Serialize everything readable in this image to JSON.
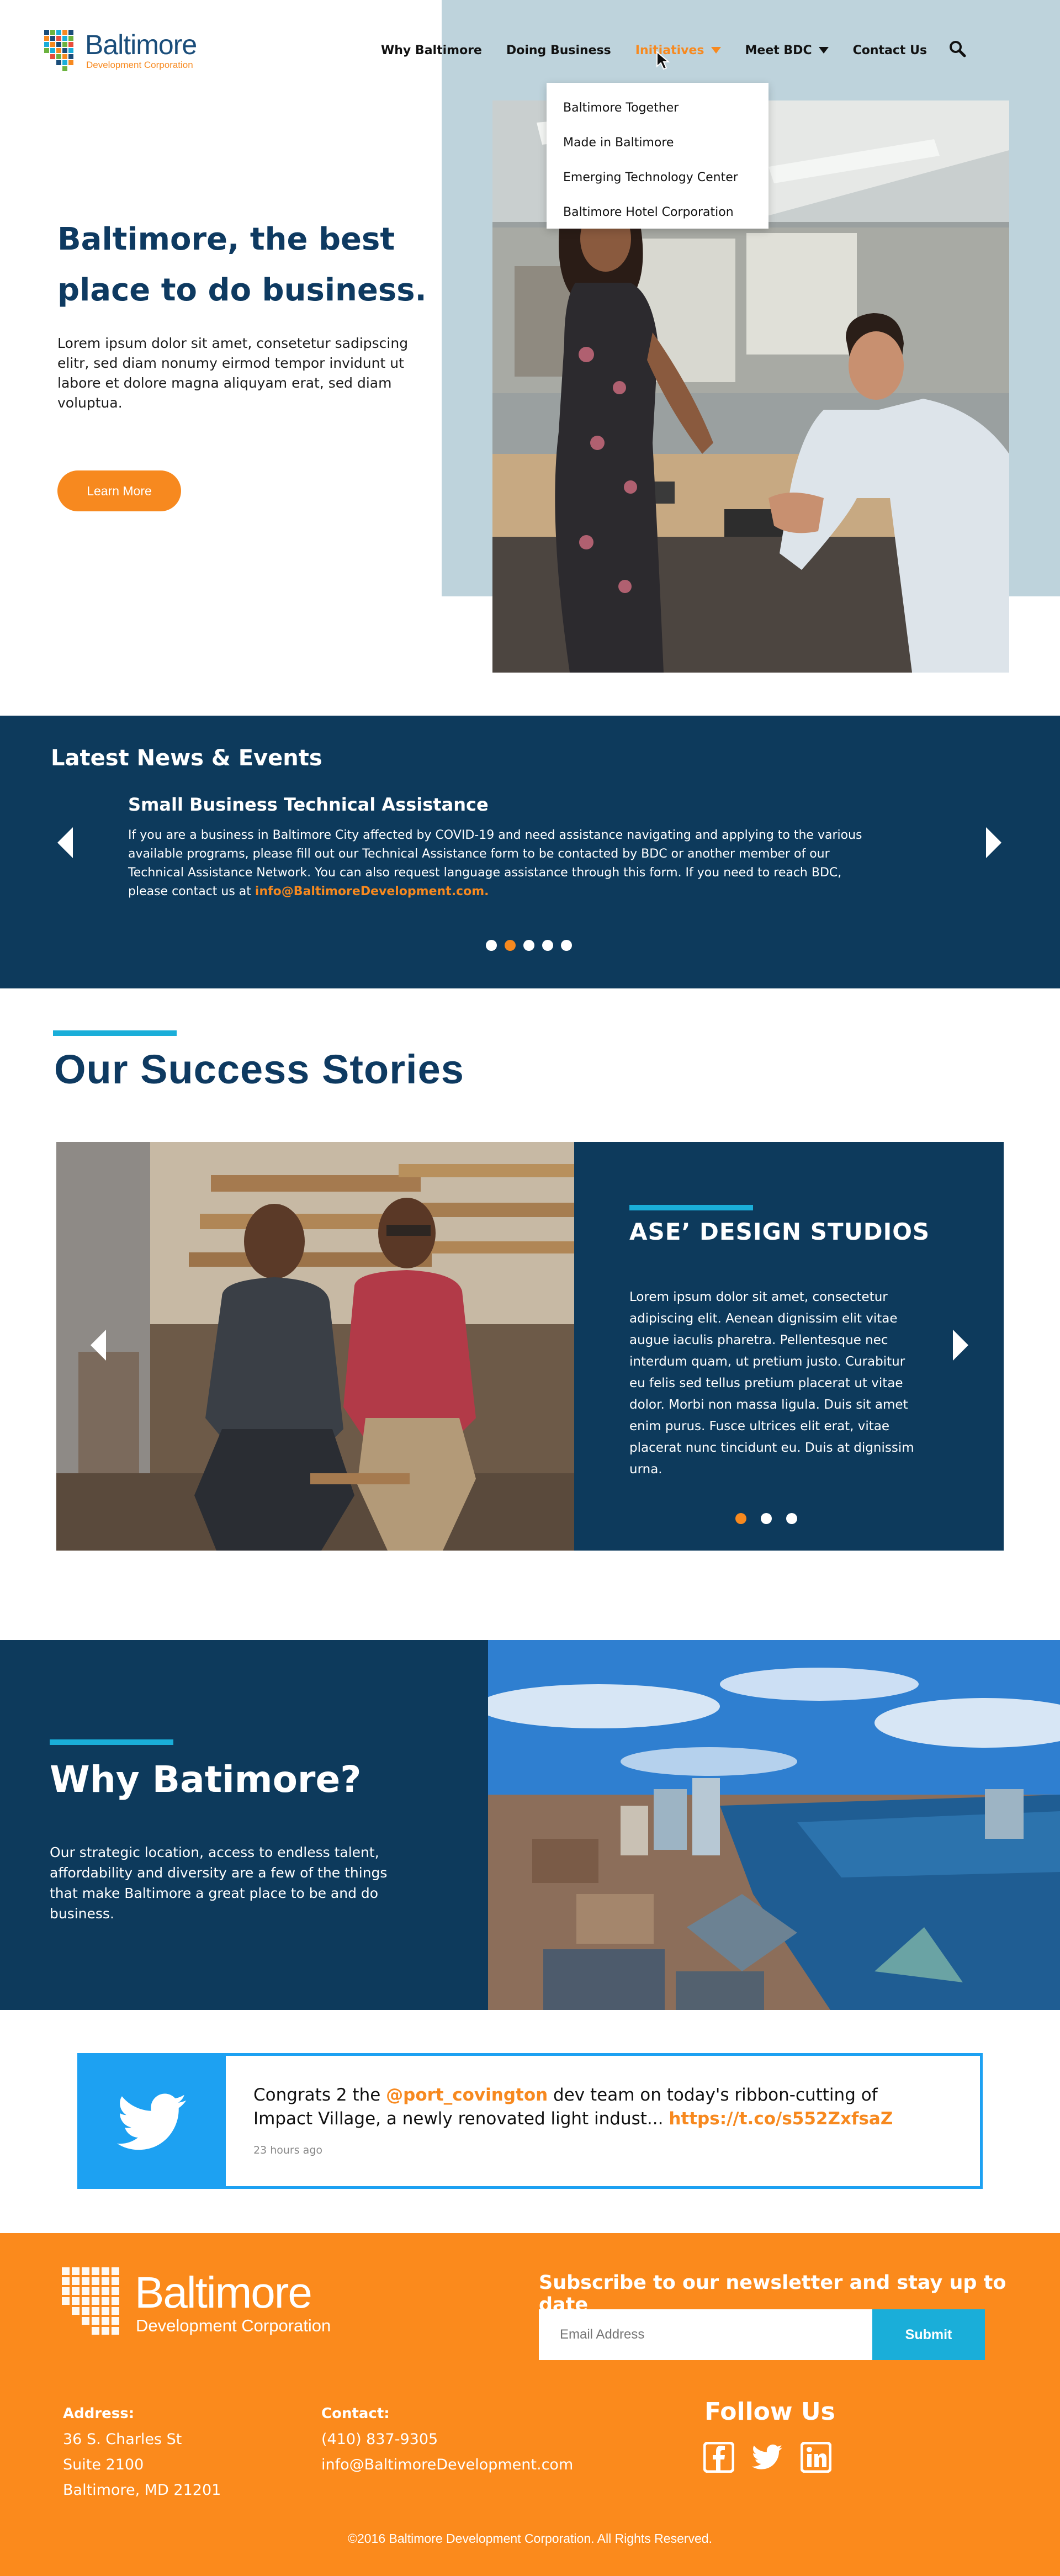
{
  "header": {
    "logo": {
      "name": "Baltimore",
      "sub": "Development Corporation"
    },
    "nav": [
      {
        "label": "Why Baltimore",
        "has_caret": false
      },
      {
        "label": "Doing Business",
        "has_caret": false
      },
      {
        "label": "Initiatives",
        "has_caret": true,
        "active": true
      },
      {
        "label": "Meet BDC",
        "has_caret": true
      },
      {
        "label": "Contact Us",
        "has_caret": false
      }
    ],
    "search_icon": "search-icon",
    "dropdown": [
      {
        "label": "Baltimore Together"
      },
      {
        "label": "Made in Baltimore"
      },
      {
        "label": "Emerging Technology Center"
      },
      {
        "label": "Baltimore Hotel Corporation"
      }
    ]
  },
  "hero": {
    "title": "Baltimore, the best place to do business.",
    "body": "Lorem ipsum dolor sit amet, consetetur sadipscing elitr, sed diam nonumy eirmod tempor invidunt ut labore et dolore magna aliquyam erat, sed diam voluptua.",
    "button": "Learn More"
  },
  "news": {
    "heading": "Latest News & Events",
    "title": "Small Business Technical Assistance",
    "body": "If you are a business in Baltimore City affected by COVID-19 and need assistance navigating and applying to the various available programs, please fill out our Technical Assistance form to be contacted by BDC or another member of our Technical Assistance Network. You can also request language assistance through this form. If you need to reach BDC, please contact us at ",
    "link": "info@BaltimoreDevelopment.com.",
    "dots": 5,
    "active_dot": 1
  },
  "success": {
    "title": "Our Success Stories",
    "story_title": "ASE’ DESIGN STUDIOS",
    "story_body": "Lorem ipsum dolor sit amet, consectetur adipiscing elit. Aenean dignissim elit vitae augue iaculis pharetra. Pellentesque nec interdum quam, ut pretium justo. Curabitur eu felis sed tellus pretium placerat ut vitae dolor. Morbi non massa ligula. Duis sit amet enim purus. Fusce ultrices elit erat, vitae placerat nunc tincidunt eu. Duis at dignissim urna.",
    "dots": 3,
    "active_dot": 0
  },
  "why": {
    "title": "Why Batimore?",
    "body": "Our strategic location, access to endless talent, affordability and diversity are a few of the things that make Baltimore a great place to be and do business."
  },
  "tweet": {
    "prefix": "Congrats 2 the ",
    "handle": "@port_covington",
    "middle": " dev team on today's ribbon-cutting of Impact Village, a newly renovated light indust... ",
    "link": "https://t.co/s552ZxfsaZ",
    "time": "23 hours ago",
    "icon": "twitter-bird-icon"
  },
  "footer": {
    "logo": {
      "name": "Baltimore",
      "sub": "Development Corporation"
    },
    "subscribe_title": "Subscribe to our newsletter and stay up to date",
    "email_placeholder": "Email Address",
    "submit": "Submit",
    "address_label": "Address:",
    "address_lines": [
      "36 S. Charles St",
      "Suite 2100",
      "Baltimore, MD 21201"
    ],
    "contact_label": "Contact:",
    "contact_lines": [
      "(410) 837-9305",
      "info@BaltimoreDevelopment.com"
    ],
    "follow": "Follow Us",
    "social": [
      "facebook-icon",
      "twitter-icon",
      "linkedin-icon"
    ],
    "copyright": "©2016 Baltimore Development Corporation. All Rights Reserved."
  },
  "colors": {
    "navy": "#0d3a5c",
    "orange": "#f7891f",
    "cyan": "#1aaed9",
    "twitter": "#1da1f2",
    "hero_bg": "#bed3dc"
  }
}
